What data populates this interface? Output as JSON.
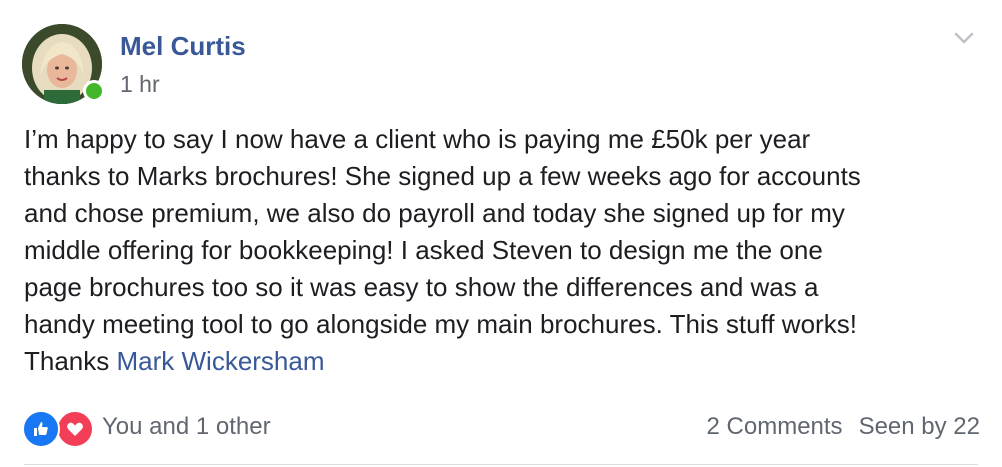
{
  "post": {
    "author": "Mel Curtis",
    "timestamp": "1 hr",
    "online": true,
    "body_text": "I’m happy to say I now have a client who is paying me £50k per year\nthanks to Marks brochures! She signed up a few weeks ago for accounts\nand chose premium, we also do payroll and today she signed up for my\nmiddle offering for bookkeeping! I asked Steven to design me the one\npage brochures too so it was easy to show the differences and was a\nhandy meeting tool to go alongside my main brochures. This stuff works!\nThanks ",
    "mention": "Mark Wickersham"
  },
  "footer": {
    "reactions_label": "You and 1 other",
    "reaction_icons": [
      "like-icon",
      "love-icon"
    ],
    "comments": "2 Comments",
    "seen": "Seen by 22"
  },
  "colors": {
    "link": "#385898",
    "text": "#1c1e21",
    "muted": "#616770",
    "like": "#1877f2",
    "love": "#f33e58",
    "online": "#42b72a"
  },
  "icons": {
    "menu": "chevron-down-icon"
  }
}
